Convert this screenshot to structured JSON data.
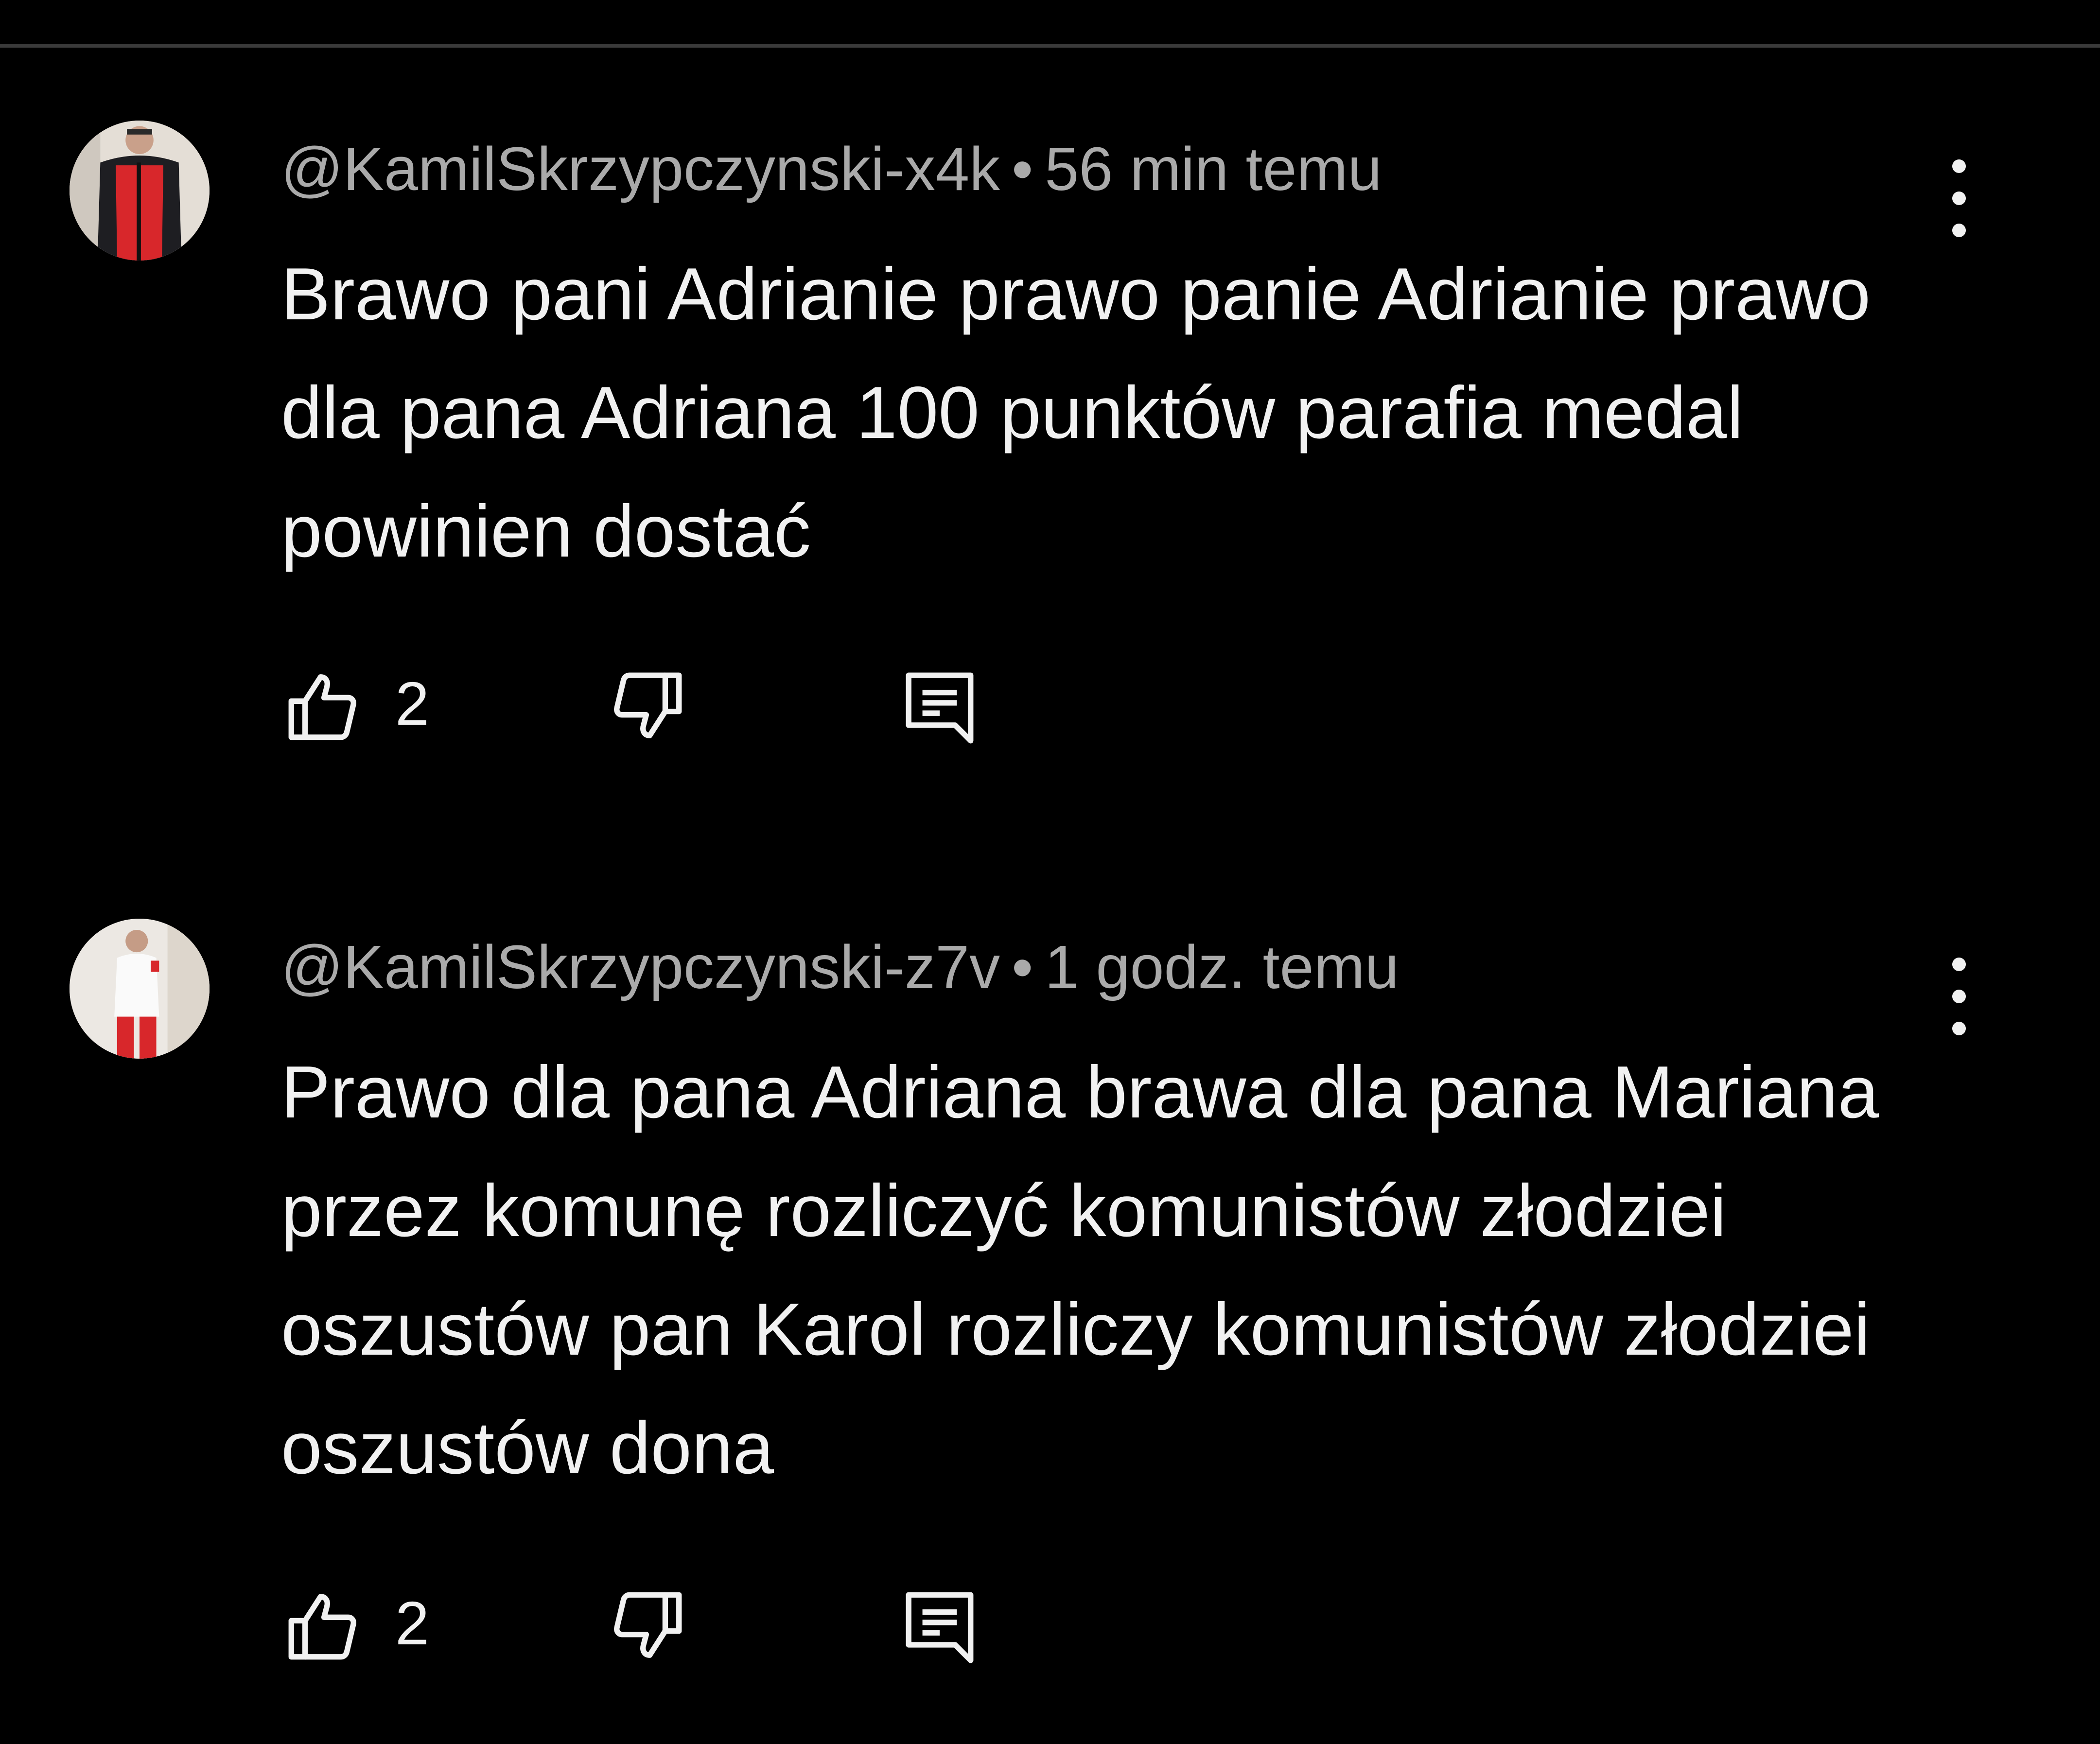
{
  "comments": [
    {
      "author": "@KamilSkrzypczynski-x4k",
      "separator": "•",
      "time": "56 min temu",
      "text": "Brawo pani Adrianie prawo panie Adrianie prawo dla pana Adriana 100 punktów parafia medal powinien dostać",
      "likes": "2",
      "icons": {
        "more": "more-vertical-icon",
        "like": "thumbs-up-icon",
        "dislike": "thumbs-down-icon",
        "reply": "reply-comment-icon"
      }
    },
    {
      "author": "@KamilSkrzypczynski-z7v",
      "separator": "•",
      "time": "1 godz. temu",
      "text": "Prawo dla pana Adriana brawa dla pana Mariana przez komunę rozliczyć komunistów złodziei oszustów pan Karol rozliczy komunistów złodziei oszustów dona",
      "likes": "2",
      "icons": {
        "more": "more-vertical-icon",
        "like": "thumbs-up-icon",
        "dislike": "thumbs-down-icon",
        "reply": "reply-comment-icon"
      }
    }
  ],
  "colors": {
    "background": "#000000",
    "text": "#f1f1f1",
    "meta": "#aaaaaa",
    "divider": "#3a3a3a"
  }
}
